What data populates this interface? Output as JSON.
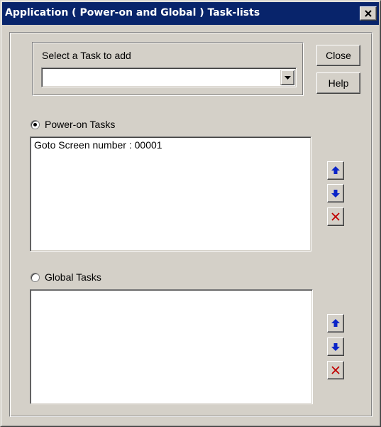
{
  "window": {
    "title": "Application ( Power-on and Global ) Task-lists"
  },
  "task_selector": {
    "label": "Select a Task to add",
    "selected_value": ""
  },
  "buttons": {
    "close_label": "Close",
    "help_label": "Help"
  },
  "power_on": {
    "label": "Power-on Tasks",
    "selected": true,
    "items": [
      "Goto Screen number : 00001"
    ]
  },
  "global": {
    "label": "Global Tasks",
    "selected": false,
    "items": []
  },
  "icons": {
    "move_up": "arrow-up-icon",
    "move_down": "arrow-down-icon",
    "delete": "delete-x-icon",
    "dropdown": "chevron-down-icon",
    "window_close": "close-icon"
  },
  "colors": {
    "title_bar": "#08246b",
    "arrow": "#0a24c8",
    "delete_x": "#c00000",
    "dialog_bg": "#d4d0c8"
  }
}
